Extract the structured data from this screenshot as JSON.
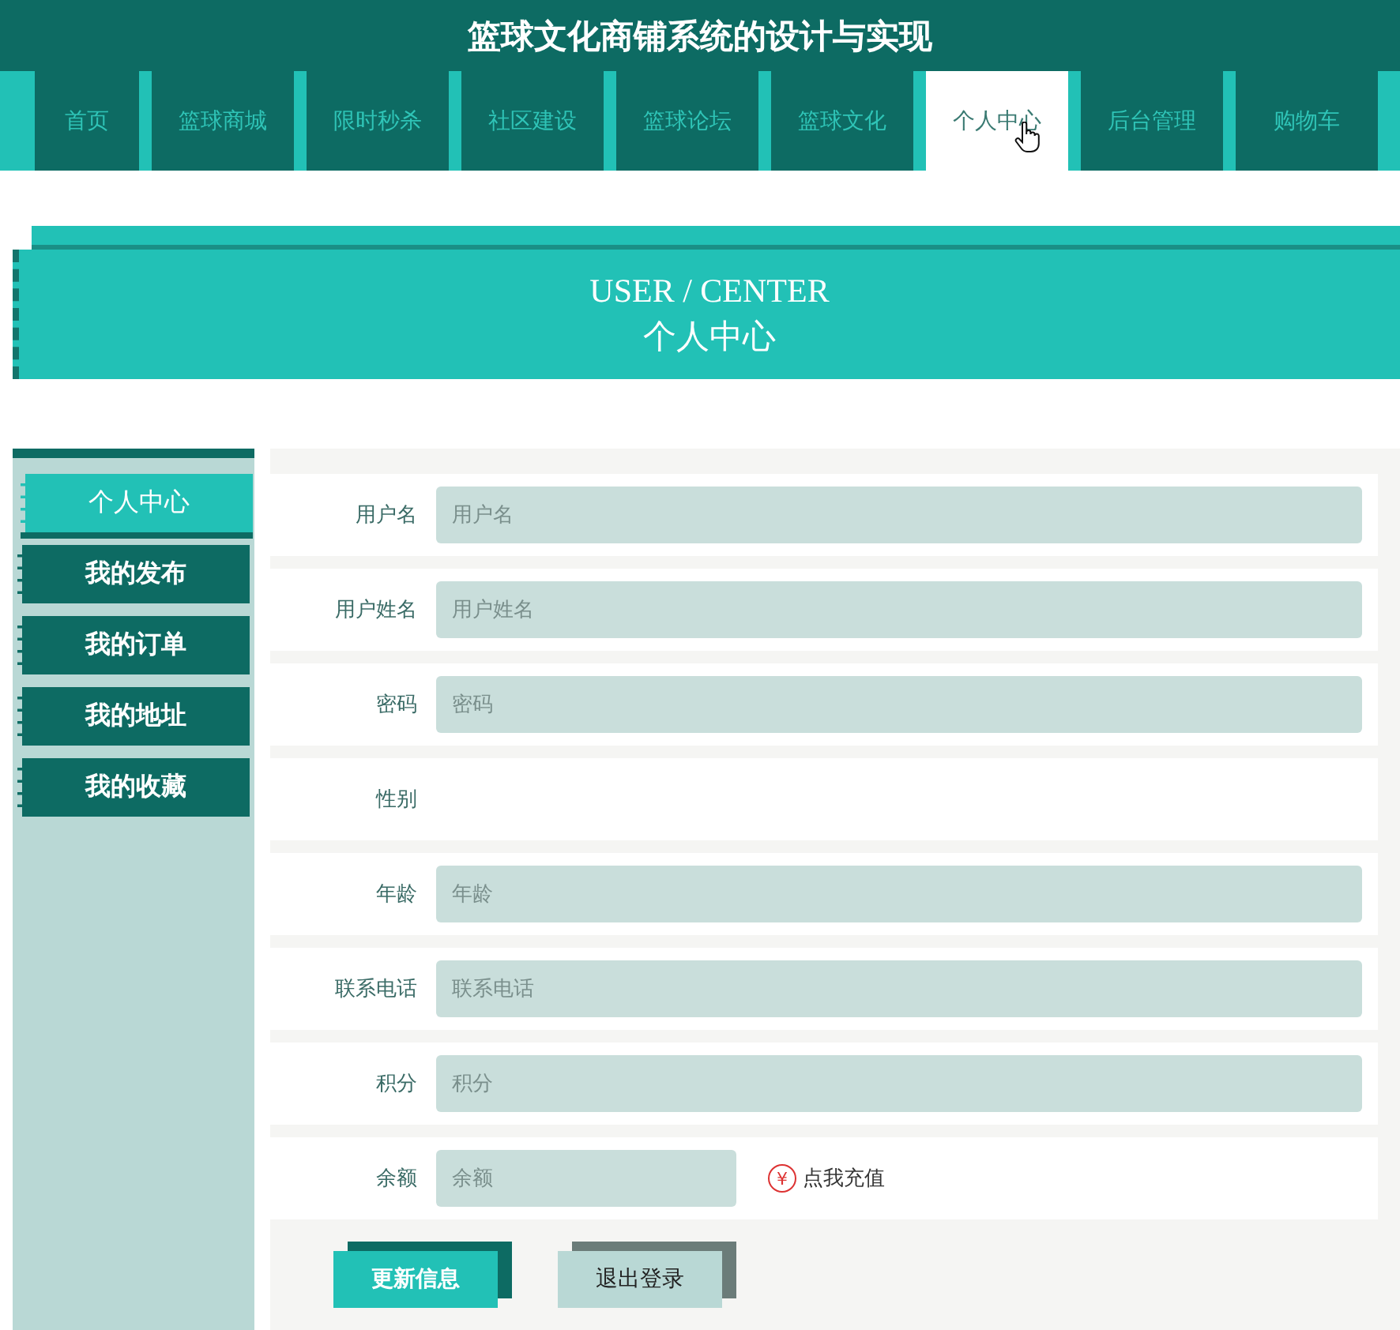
{
  "site_title": "篮球文化商铺系统的设计与实现",
  "nav": [
    {
      "label": "首页",
      "selected": false
    },
    {
      "label": "篮球商城",
      "selected": false
    },
    {
      "label": "限时秒杀",
      "selected": false
    },
    {
      "label": "社区建设",
      "selected": false
    },
    {
      "label": "篮球论坛",
      "selected": false
    },
    {
      "label": "篮球文化",
      "selected": false
    },
    {
      "label": "个人中心",
      "selected": true
    },
    {
      "label": "后台管理",
      "selected": false
    },
    {
      "label": "购物车",
      "selected": false
    }
  ],
  "banner": {
    "title_en": "USER / CENTER",
    "title": "个人中心"
  },
  "sidebar": {
    "items": [
      {
        "label": "个人中心",
        "selected": true
      },
      {
        "label": "我的发布",
        "selected": false
      },
      {
        "label": "我的订单",
        "selected": false
      },
      {
        "label": "我的地址",
        "selected": false
      },
      {
        "label": "我的收藏",
        "selected": false
      }
    ]
  },
  "form": {
    "fields": [
      {
        "kind": "text",
        "label": "用户名",
        "placeholder": "用户名"
      },
      {
        "kind": "text",
        "label": "用户姓名",
        "placeholder": "用户姓名"
      },
      {
        "kind": "text",
        "label": "密码",
        "placeholder": "密码"
      },
      {
        "kind": "blank",
        "label": "性别"
      },
      {
        "kind": "text",
        "label": "年龄",
        "placeholder": "年龄"
      },
      {
        "kind": "text",
        "label": "联系电话",
        "placeholder": "联系电话"
      },
      {
        "kind": "text",
        "label": "积分",
        "placeholder": "积分"
      },
      {
        "kind": "balance",
        "label": "余额",
        "placeholder": "余额",
        "link": "点我充值",
        "link_icon": "¥"
      }
    ],
    "buttons": [
      {
        "kind": "primary",
        "label": "更新信息"
      },
      {
        "kind": "secondary",
        "label": "退出登录"
      }
    ]
  }
}
